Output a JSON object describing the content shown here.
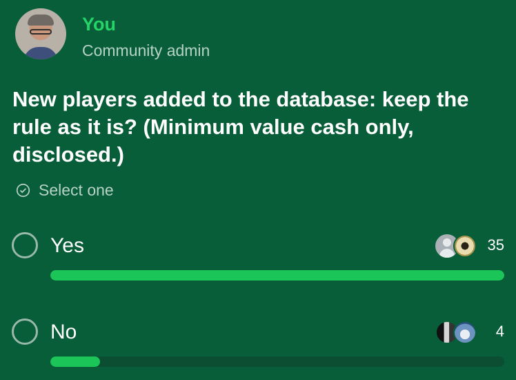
{
  "sender": {
    "name": "You",
    "role": "Community admin"
  },
  "poll": {
    "question": "New players added to the database: keep the rule as it is? (Minimum value cash only, disclosed.)",
    "hint": "Select one",
    "options": [
      {
        "label": "Yes",
        "votes": "35",
        "fraction": 1.0
      },
      {
        "label": "No",
        "votes": "4",
        "fraction": 0.11
      }
    ]
  },
  "colors": {
    "background": "#075e39",
    "accent": "#25d366",
    "bar": "#1cc557"
  },
  "icons": {
    "hint": "check-circle-icon"
  }
}
